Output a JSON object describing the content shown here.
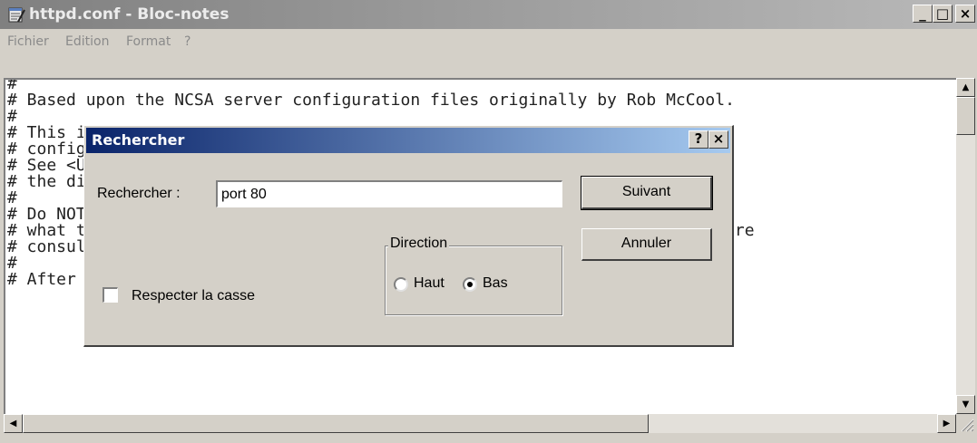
{
  "window": {
    "title": "httpd.conf - Bloc-notes",
    "minimize_glyph": "_",
    "maximize_glyph": "□",
    "close_glyph": "×"
  },
  "menu": [
    "Fichier",
    "Edition",
    "Format",
    "?"
  ],
  "editor": {
    "text": "#\n# Based upon the NCSA server configuration files originally by Rob McCool.\n#\n# This is the main Apache server configuration file.  It contains the\n# configuration directives that give the server its instructions.\n# See <URL:http://httpd.apache.org/docs/> for detailed information about\n# the directives.\n#\n# Do NOT simply read the instructions in here without understanding\n# what they do.  They're here only as hints or reminders.  If you are unsure\n# consult the online docs. You have been warned.\n#\n# After this file is processed, the server will look for and process"
  },
  "dialog": {
    "title": "Rechercher",
    "help_glyph": "?",
    "close_glyph": "×",
    "find_label": "Rechercher :",
    "find_value": "port 80",
    "next_button": "Suivant",
    "cancel_button": "Annuler",
    "direction_label": "Direction",
    "up_label": "Haut",
    "down_label": "Bas",
    "selected_direction": "Bas",
    "match_case_label": "Respecter la casse",
    "match_case_checked": false
  },
  "icons": {
    "app": "notepad-icon",
    "scroll_up": "arrow-up-icon",
    "scroll_down": "arrow-down-icon",
    "scroll_left": "arrow-left-icon",
    "scroll_right": "arrow-right-icon",
    "grip": "resize-grip-icon"
  }
}
